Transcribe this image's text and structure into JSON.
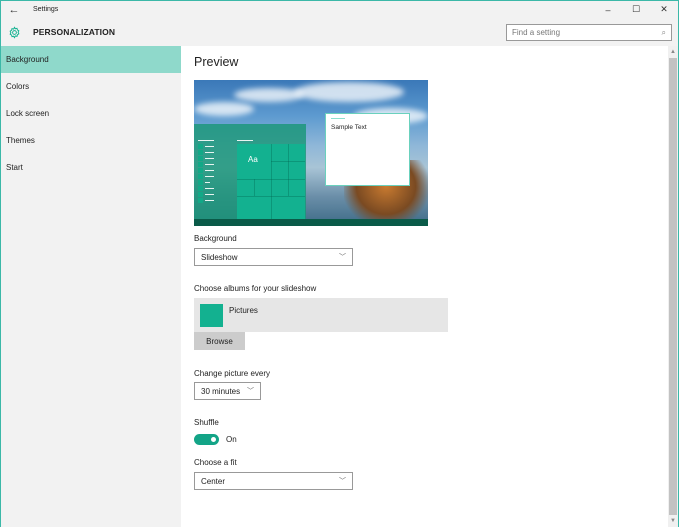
{
  "window": {
    "title": "Settings",
    "back_icon": "←",
    "minimize_icon": "–",
    "maximize_icon": "☐",
    "close_icon": "✕"
  },
  "header": {
    "section_title": "PERSONALIZATION",
    "search_placeholder": "Find a setting",
    "search_icon": "⌕"
  },
  "sidebar": {
    "items": [
      {
        "label": "Background",
        "active": true
      },
      {
        "label": "Colors",
        "active": false
      },
      {
        "label": "Lock screen",
        "active": false
      },
      {
        "label": "Themes",
        "active": false
      },
      {
        "label": "Start",
        "active": false
      }
    ]
  },
  "main": {
    "preview_title": "Preview",
    "preview": {
      "tile_text": "Aa",
      "sample_text": "Sample Text"
    },
    "background": {
      "label": "Background",
      "value": "Slideshow"
    },
    "albums": {
      "label": "Choose albums for your slideshow",
      "items": [
        {
          "name": "Pictures"
        }
      ],
      "browse_label": "Browse"
    },
    "interval": {
      "label": "Change picture every",
      "value": "30 minutes"
    },
    "shuffle": {
      "label": "Shuffle",
      "state": "On"
    },
    "fit": {
      "label": "Choose a fit",
      "value": "Center"
    }
  },
  "colors": {
    "accent": "#13b190",
    "selected_nav": "#8fd9cb"
  }
}
